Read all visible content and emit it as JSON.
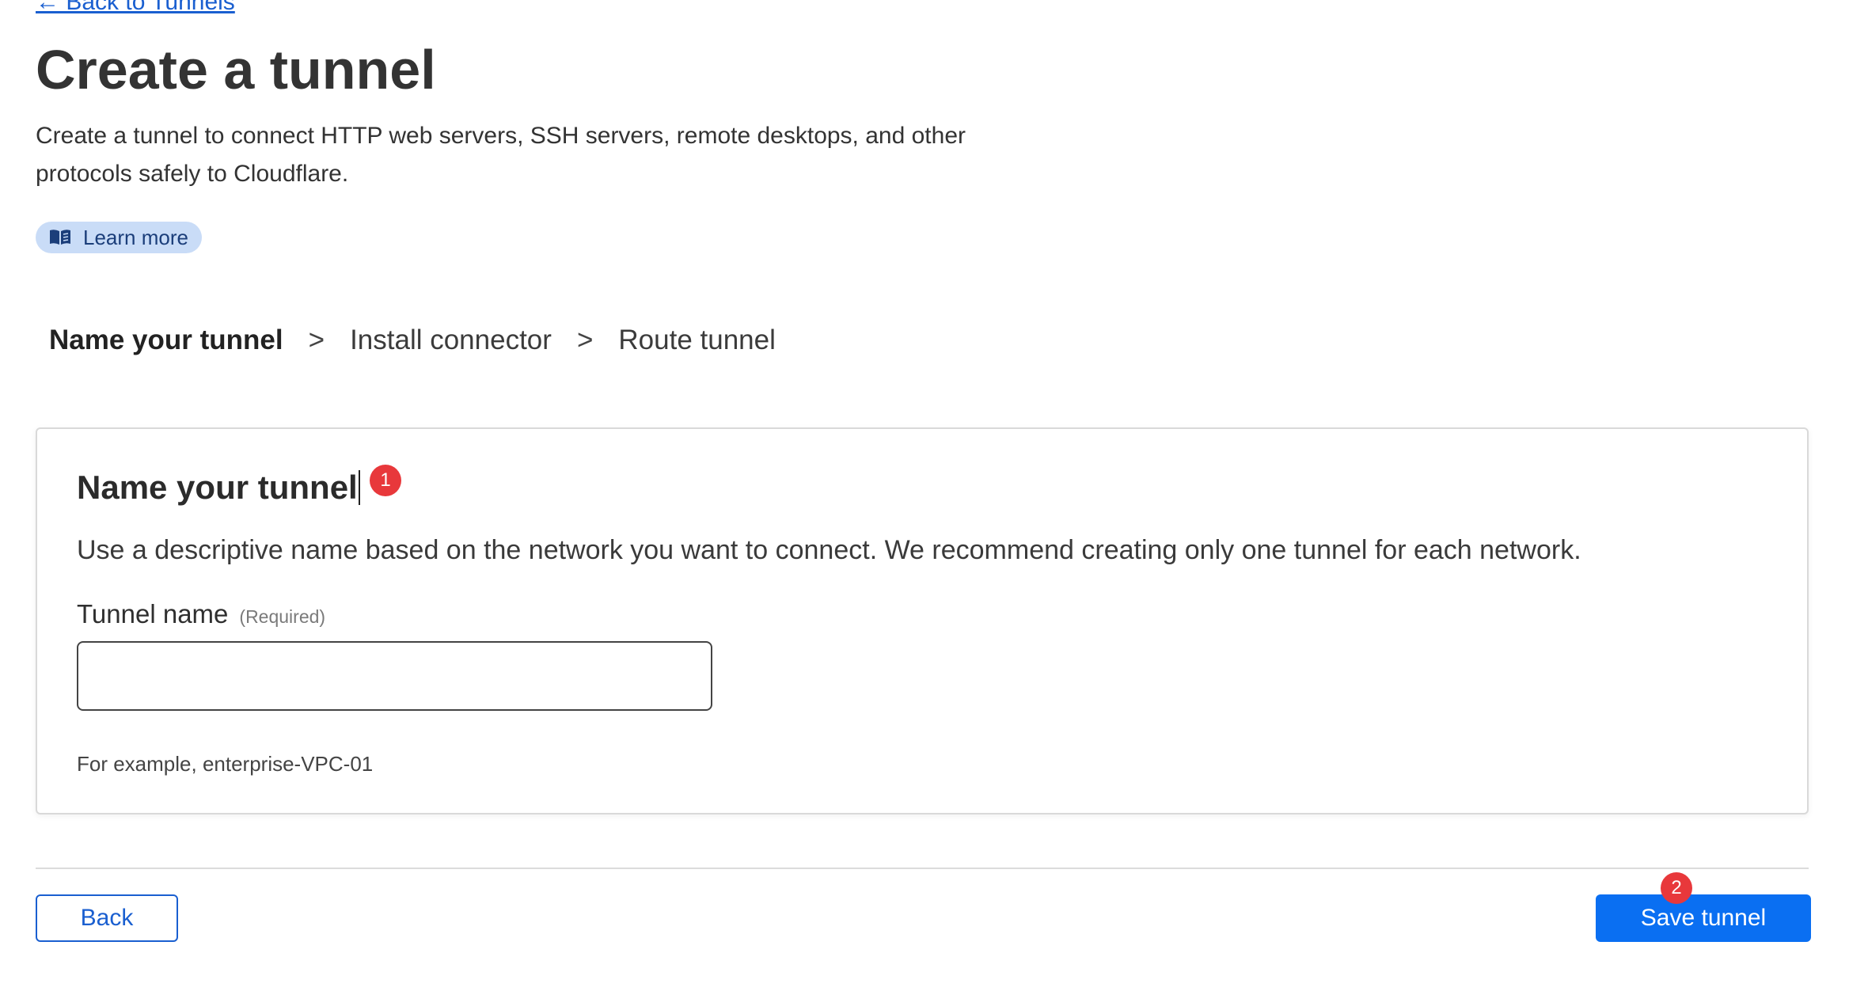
{
  "header": {
    "back_link": "← Back to Tunnels",
    "title": "Create a tunnel",
    "description": "Create a tunnel to connect HTTP web servers, SSH servers, remote desktops, and other protocols safely to Cloudflare.",
    "learn_more": "Learn more",
    "learn_more_icon": "book-icon"
  },
  "steps": {
    "items": [
      {
        "label": "Name your tunnel",
        "active": true
      },
      {
        "label": "Install connector",
        "active": false
      },
      {
        "label": "Route tunnel",
        "active": false
      }
    ],
    "separator": ">"
  },
  "card": {
    "title": "Name your tunnel",
    "description": "Use a descriptive name based on the network you want to connect. We recommend creating only one tunnel for each network.",
    "field_label": "Tunnel name",
    "field_required": "(Required)",
    "input_value": "",
    "helper": "For example, enterprise-VPC-01"
  },
  "footer": {
    "back_label": "Back",
    "save_label": "Save tunnel"
  },
  "annotations": {
    "badge_1": "1",
    "badge_2": "2"
  },
  "colors": {
    "accent": "#0a6ff2",
    "link": "#1a5fd0",
    "pill_bg": "#c9dcf7",
    "badge": "#e8383b"
  }
}
